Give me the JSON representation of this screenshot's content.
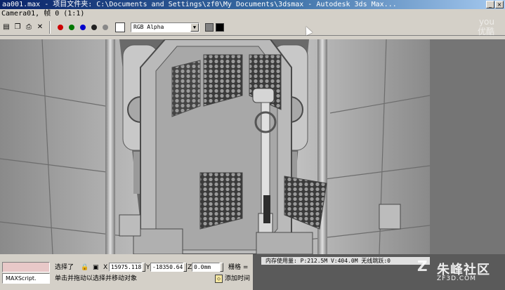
{
  "window": {
    "title": "aa001.max    - 项目文件夹: C:\\Documents and Settings\\zf0\\My Documents\\3dsmax    - Autodesk 3ds Max..."
  },
  "frame_window": {
    "caption": "Camera01, 帧 0 (1:1)"
  },
  "toolbar": {
    "icons": [
      "save-icon",
      "copy-icon",
      "print-icon",
      "close-icon"
    ],
    "channels": [
      {
        "name": "red-channel",
        "color": "#cc0000"
      },
      {
        "name": "green-channel",
        "color": "#007700"
      },
      {
        "name": "blue-channel",
        "color": "#0000cc"
      },
      {
        "name": "alpha-channel",
        "color": "#222222"
      },
      {
        "name": "mono-channel",
        "color": "#888888"
      }
    ],
    "channel_select": "RGB Alpha",
    "swatch_white": "#ffffff",
    "swatch_gray": "#808080",
    "swatch_black": "#000000"
  },
  "status": {
    "selection": "选择了",
    "x_label": "X",
    "x_value": "15975.118",
    "y_label": "Y",
    "y_value": "-18350.64",
    "z_label": "Z",
    "z_value": "0.0mm",
    "grid_label": "栅格 =",
    "maxscript": "MAXScript.",
    "prompt": "单击并拖动以选择并移动对象",
    "add_time_tag": "添加时间",
    "memory": "内存使用量: P:212.5M V:404.0M    无线跳跃:0"
  },
  "watermark": {
    "logo": "Z",
    "name": "朱峰社区",
    "url": "ZF3D.COM",
    "youku_line1": "you",
    "youku_line2": "优酷"
  }
}
